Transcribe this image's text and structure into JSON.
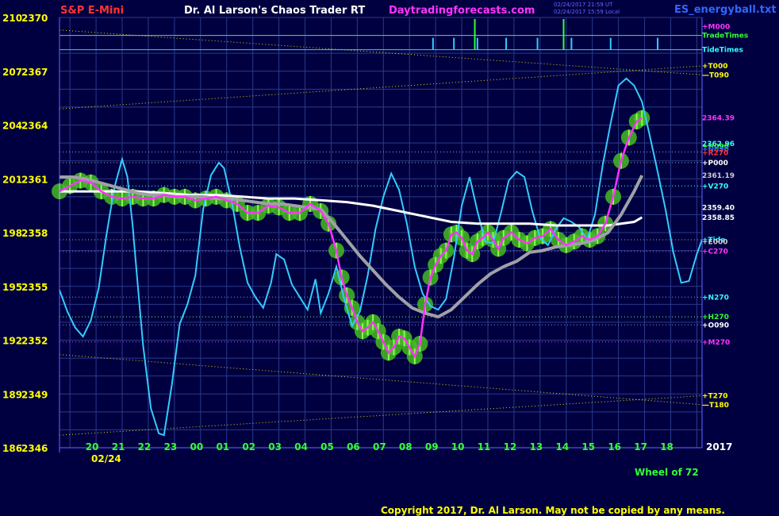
{
  "header": {
    "symbol": "S&P E-Mini",
    "title": "Dr. Al Larson's Chaos Trader RT",
    "site": "Daytradingforecasts.com",
    "timestamp_line1": "02/24/2017 21:59 UT",
    "timestamp_line2": "02/24/2017 15:59 Local",
    "filename": "ES_energyball.txt"
  },
  "footer": {
    "copyright": "Copyright 2017, Dr. Al Larson. May not be copied by any means.",
    "wheel": "Wheel of 72",
    "year": "2017",
    "date": "02/24"
  },
  "chart_data": {
    "type": "line",
    "y_axis": {
      "ylim": [
        2346,
        2370
      ],
      "tick_labels": [
        {
          "left": "210",
          "right": "2370",
          "value": 2370
        },
        {
          "left": "207",
          "right": "2367",
          "value": 2367
        },
        {
          "left": "204",
          "right": "2364",
          "value": 2364
        },
        {
          "left": "201",
          "right": "2361",
          "value": 2361
        },
        {
          "left": "198",
          "right": "2358",
          "value": 2358
        },
        {
          "left": "195",
          "right": "2355",
          "value": 2355
        },
        {
          "left": "192",
          "right": "2352",
          "value": 2352
        },
        {
          "left": "189",
          "right": "2349",
          "value": 2349
        },
        {
          "left": "186",
          "right": "2346",
          "value": 2346
        }
      ]
    },
    "x_axis": {
      "hour_labels": [
        "20",
        "21",
        "22",
        "23",
        "00",
        "01",
        "02",
        "03",
        "04",
        "05",
        "06",
        "07",
        "08",
        "09",
        "10",
        "11",
        "12",
        "13",
        "14",
        "15",
        "16",
        "17",
        "18"
      ],
      "xlim": [
        0,
        24.6
      ]
    },
    "right_labels": [
      {
        "text": "+M000",
        "y": 2369.5,
        "color": "#ff33ff"
      },
      {
        "text": "TradeTimes",
        "y": 2369.0,
        "color": "#33ff33"
      },
      {
        "text": "TideTimes",
        "y": 2368.2,
        "color": "#33ffff"
      },
      {
        "text": "+T000",
        "y": 2367.3,
        "color": "#ffff00"
      },
      {
        "text": "—T090",
        "y": 2366.8,
        "color": "#ffff00"
      },
      {
        "text": "2364.39",
        "y": 2364.39,
        "color": "#ff33ff"
      },
      {
        "text": "2362.96",
        "y": 2362.96,
        "color": "#33ffff"
      },
      {
        "text": "+H090",
        "y": 2362.8,
        "color": "#33ff33"
      },
      {
        "text": "+N090",
        "y": 2362.65,
        "color": "#3366ff"
      },
      {
        "text": "+R270",
        "y": 2362.45,
        "color": "#ff3333"
      },
      {
        "text": "+P000",
        "y": 2361.9,
        "color": "#ffffff"
      },
      {
        "text": "2361.19",
        "y": 2361.19,
        "color": "#cccccc"
      },
      {
        "text": "+V270",
        "y": 2360.6,
        "color": "#33ffff"
      },
      {
        "text": "2359.40",
        "y": 2359.4,
        "color": "#ffffff"
      },
      {
        "text": "2358.85",
        "y": 2358.85,
        "color": "#ffffff"
      },
      {
        "text": "+Tide",
        "y": 2357.6,
        "color": "#33ffff"
      },
      {
        "text": "+E000",
        "y": 2357.5,
        "color": "#cccccc"
      },
      {
        "text": "+C270",
        "y": 2356.95,
        "color": "#ff33ff"
      },
      {
        "text": "+N270",
        "y": 2354.4,
        "color": "#33ffff"
      },
      {
        "text": "+H270",
        "y": 2353.3,
        "color": "#33ff33"
      },
      {
        "text": "+O090",
        "y": 2352.85,
        "color": "#ffffff"
      },
      {
        "text": "+M270",
        "y": 2351.9,
        "color": "#ff33ff"
      },
      {
        "text": "+T270",
        "y": 2348.9,
        "color": "#ffff00"
      },
      {
        "text": "—T180",
        "y": 2348.4,
        "color": "#ffff00"
      }
    ],
    "hlines": [
      {
        "y": 2362.5,
        "color": "#9999ff"
      },
      {
        "y": 2361.9,
        "color": "#aaaaaa"
      },
      {
        "y": 2360.6,
        "color": "#33ffff"
      },
      {
        "y": 2357.6,
        "color": "#aaaaaa"
      },
      {
        "y": 2356.95,
        "color": "#ff33ff"
      },
      {
        "y": 2354.4,
        "color": "#8888ff"
      },
      {
        "y": 2353.3,
        "color": "#66ff66"
      },
      {
        "y": 2352.85,
        "color": "#8888ff"
      },
      {
        "y": 2351.9,
        "color": "#ff33ff"
      }
    ],
    "diag_lines": [
      {
        "points": [
          [
            0,
            2369.3
          ],
          [
            24.6,
            2366.8
          ]
        ],
        "color": "#dddd00"
      },
      {
        "points": [
          [
            0,
            2364.9
          ],
          [
            24.6,
            2367.3
          ]
        ],
        "color": "#dddd00"
      },
      {
        "points": [
          [
            0,
            2351.2
          ],
          [
            24.6,
            2348.4
          ]
        ],
        "color": "#dddd00"
      },
      {
        "points": [
          [
            0,
            2346.7
          ],
          [
            24.6,
            2348.9
          ]
        ],
        "color": "#dddd00"
      }
    ],
    "tide_times": [
      14.3,
      15.1,
      16.0,
      17.1,
      18.3,
      19.6,
      21.1,
      22.9
    ],
    "trade_times": [
      15.9,
      19.3
    ],
    "series": [
      {
        "name": "Tide",
        "color": "#33ccff",
        "x": [
          0,
          0.3,
          0.6,
          0.9,
          1.2,
          1.5,
          1.8,
          2.1,
          2.4,
          2.6,
          2.8,
          3.0,
          3.2,
          3.5,
          3.8,
          4.0,
          4.3,
          4.6,
          4.9,
          5.2,
          5.5,
          5.8,
          6.1,
          6.3,
          6.6,
          6.9,
          7.2,
          7.5,
          7.8,
          8.1,
          8.3,
          8.6,
          8.9,
          9.2,
          9.5,
          9.8,
          10.0,
          10.3,
          10.6,
          10.9,
          11.2,
          11.5,
          11.8,
          12.1,
          12.4,
          12.7,
          13.0,
          13.3,
          13.6,
          13.9,
          14.2,
          14.5,
          14.8,
          15.1,
          15.4,
          15.7,
          16.0,
          16.3,
          16.6,
          16.9,
          17.2,
          17.5,
          17.8,
          18.1,
          18.4,
          18.7,
          19.0,
          19.3,
          19.6,
          19.9,
          20.2,
          20.5,
          20.8,
          21.1,
          21.4,
          21.7,
          22.0,
          22.3,
          22.6,
          22.9,
          23.2,
          23.5,
          23.8,
          24.1,
          24.4,
          24.6
        ],
        "y": [
          2354.8,
          2353.6,
          2352.7,
          2352.2,
          2353.1,
          2354.9,
          2357.9,
          2360.5,
          2362.1,
          2361.1,
          2358.4,
          2355.0,
          2351.7,
          2348.2,
          2346.8,
          2346.7,
          2349.5,
          2352.9,
          2354.0,
          2355.6,
          2359.3,
          2361.2,
          2361.9,
          2361.6,
          2359.7,
          2357.2,
          2355.2,
          2354.4,
          2353.8,
          2355.2,
          2356.8,
          2356.5,
          2355.1,
          2354.4,
          2353.7,
          2355.4,
          2353.5,
          2354.6,
          2356.1,
          2354.3,
          2352.8,
          2353.6,
          2355.6,
          2358.2,
          2360.0,
          2361.3,
          2360.4,
          2358.5,
          2356.1,
          2354.6,
          2353.9,
          2353.7,
          2354.3,
          2356.6,
          2359.5,
          2361.1,
          2359.2,
          2357.5,
          2357.4,
          2359.1,
          2360.9,
          2361.4,
          2361.1,
          2359.2,
          2357.7,
          2357.3,
          2358.2,
          2358.8,
          2358.6,
          2358.3,
          2357.6,
          2359.0,
          2361.8,
          2364.1,
          2366.2,
          2366.6,
          2366.2,
          2365.3,
          2363.4,
          2361.4,
          2359.3,
          2356.9,
          2355.2,
          2355.3,
          2356.8,
          2357.6
        ]
      },
      {
        "name": "EMA-fast",
        "color": "#ff33ff",
        "x": [
          0,
          0.4,
          0.8,
          1.2,
          1.6,
          2.0,
          2.4,
          2.8,
          3.2,
          3.6,
          4.0,
          4.4,
          4.8,
          5.2,
          5.6,
          6.0,
          6.4,
          6.8,
          7.2,
          7.6,
          8.0,
          8.4,
          8.8,
          9.2,
          9.6,
          10.0,
          10.3,
          10.6,
          10.8,
          11.0,
          11.2,
          11.4,
          11.6,
          11.8,
          12.0,
          12.2,
          12.4,
          12.6,
          12.8,
          13.0,
          13.2,
          13.4,
          13.6,
          13.8,
          14.0,
          14.2,
          14.4,
          14.6,
          14.8,
          15.0,
          15.2,
          15.4,
          15.6,
          15.8,
          16.0,
          16.2,
          16.4,
          16.6,
          16.8,
          17.0,
          17.3,
          17.6,
          17.9,
          18.2,
          18.5,
          18.8,
          19.1,
          19.4,
          19.7,
          20.0,
          20.3,
          20.6,
          20.9,
          21.2,
          21.5,
          21.8,
          22.1,
          22.3
        ],
        "y": [
          2360.3,
          2360.6,
          2360.9,
          2360.8,
          2360.3,
          2360.0,
          2359.9,
          2360.0,
          2359.9,
          2359.9,
          2360.1,
          2360.0,
          2360.0,
          2359.8,
          2359.9,
          2360.0,
          2359.8,
          2359.6,
          2359.1,
          2359.1,
          2359.5,
          2359.4,
          2359.1,
          2359.1,
          2359.6,
          2359.2,
          2358.5,
          2357.0,
          2355.5,
          2354.5,
          2353.8,
          2353.0,
          2352.5,
          2352.7,
          2353.0,
          2352.5,
          2351.9,
          2351.3,
          2351.6,
          2352.2,
          2352.1,
          2351.6,
          2351.1,
          2351.8,
          2354.0,
          2355.5,
          2356.2,
          2356.7,
          2357.0,
          2357.9,
          2358.0,
          2357.7,
          2357.0,
          2356.8,
          2357.5,
          2357.7,
          2358.0,
          2357.6,
          2357.1,
          2357.7,
          2358.0,
          2357.6,
          2357.4,
          2357.7,
          2357.8,
          2358.2,
          2357.6,
          2357.3,
          2357.5,
          2357.8,
          2357.6,
          2357.8,
          2358.5,
          2360.0,
          2362.0,
          2363.3,
          2364.2,
          2364.39
        ]
      },
      {
        "name": "EMA-slow",
        "color": "#a0a0a8",
        "x": [
          0,
          0.5,
          1,
          1.5,
          2,
          2.5,
          3,
          3.5,
          4,
          4.5,
          5,
          5.5,
          6,
          6.5,
          7,
          7.5,
          8,
          8.5,
          9,
          9.5,
          10,
          10.5,
          11,
          11.5,
          12,
          12.5,
          13,
          13.5,
          14,
          14.5,
          15,
          15.5,
          16,
          16.5,
          17,
          17.5,
          18,
          18.5,
          19,
          19.5,
          20,
          20.5,
          21,
          21.5,
          22,
          22.3
        ],
        "y": [
          2361.1,
          2361.1,
          2361.0,
          2360.8,
          2360.6,
          2360.4,
          2360.2,
          2360.1,
          2360.1,
          2360.0,
          2360.0,
          2360.0,
          2359.9,
          2359.9,
          2359.8,
          2359.7,
          2359.6,
          2359.6,
          2359.5,
          2359.4,
          2359.3,
          2358.5,
          2357.6,
          2356.7,
          2355.9,
          2355.1,
          2354.4,
          2353.8,
          2353.5,
          2353.3,
          2353.7,
          2354.4,
          2355.1,
          2355.7,
          2356.1,
          2356.4,
          2356.9,
          2357.0,
          2357.2,
          2357.3,
          2357.4,
          2357.6,
          2358.0,
          2359.0,
          2360.3,
          2361.19
        ]
      },
      {
        "name": "Average",
        "color": "#ffffff",
        "x": [
          0,
          1,
          2,
          3,
          4,
          5,
          6,
          7,
          8,
          9,
          10,
          11,
          12,
          13,
          14,
          15,
          16,
          17,
          18,
          19,
          20,
          21,
          22,
          22.3
        ],
        "y": [
          2360.3,
          2360.3,
          2360.3,
          2360.3,
          2360.2,
          2360.1,
          2360.1,
          2360.0,
          2359.9,
          2359.9,
          2359.8,
          2359.7,
          2359.5,
          2359.2,
          2358.9,
          2358.6,
          2358.5,
          2358.5,
          2358.5,
          2358.4,
          2358.4,
          2358.4,
          2358.6,
          2358.85
        ]
      }
    ]
  }
}
